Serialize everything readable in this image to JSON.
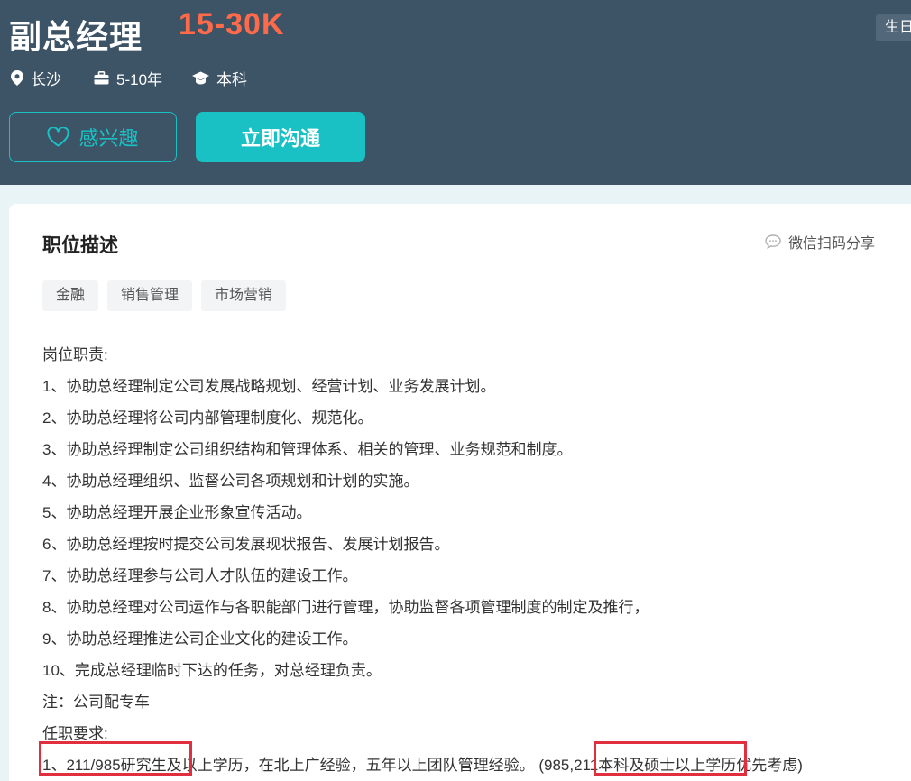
{
  "header": {
    "title": "副总经理",
    "salary": "15-30K",
    "corner_tag": "生日",
    "location": "长沙",
    "experience": "5-10年",
    "education": "本科",
    "interest_label": "感兴趣",
    "chat_label": "立即沟通"
  },
  "icons": {
    "location": "map-pin-icon",
    "experience": "briefcase-icon",
    "education": "graduation-cap-icon",
    "interest": "heart-icon",
    "share": "chat-bubble-icon"
  },
  "colors": {
    "header_bg": "#3d5366",
    "salary": "#ff6a4a",
    "accent": "#19c1c5",
    "highlight_box": "#e0303f"
  },
  "section": {
    "title": "职位描述",
    "share_label": "微信扫码分享",
    "tags": [
      "金融",
      "销售管理",
      "市场营销"
    ]
  },
  "description": {
    "lines": [
      "岗位职责:",
      "1、协助总经理制定公司发展战略规划、经营计划、业务发展计划。",
      "2、协助总经理将公司内部管理制度化、规范化。",
      "3、协助总经理制定公司组织结构和管理体系、相关的管理、业务规范和制度。",
      "4、协助总经理组织、监督公司各项规划和计划的实施。",
      "5、协助总经理开展企业形象宣传活动。",
      "6、协助总经理按时提交公司发展现状报告、发展计划报告。",
      "7、协助总经理参与公司人才队伍的建设工作。",
      "8、协助总经理对公司运作与各职能部门进行管理，协助监督各项管理制度的制定及推行，",
      "9、协助总经理推进公司企业文化的建设工作。",
      "10、完成总经理临时下达的任务，对总经理负责。",
      "注：公司配专车",
      "任职要求:",
      "1、211/985研究生及以上学历，在北上广经验，五年以上团队管理经验。 (985,211本科及硕士以上学历优先考虑)"
    ]
  }
}
